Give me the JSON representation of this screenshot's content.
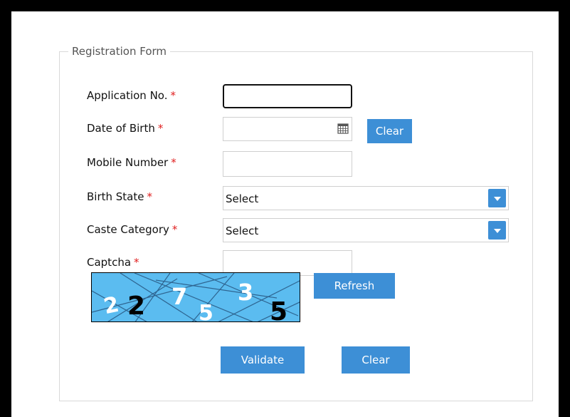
{
  "form": {
    "legend": "Registration Form",
    "required_mark": "*",
    "fields": {
      "application_no": {
        "label": "Application No.",
        "value": ""
      },
      "date_of_birth": {
        "label": "Date of Birth",
        "value": "",
        "clear_label": "Clear"
      },
      "mobile_number": {
        "label": "Mobile Number",
        "value": ""
      },
      "birth_state": {
        "label": "Birth State",
        "selected": "Select"
      },
      "caste_category": {
        "label": "Caste Category",
        "selected": "Select"
      },
      "captcha": {
        "label": "Captcha",
        "value": ""
      }
    },
    "captcha_image": {
      "digits": [
        "2",
        "2",
        "7",
        "5",
        "3",
        "5"
      ],
      "refresh_label": "Refresh"
    },
    "buttons": {
      "validate_label": "Validate",
      "clear_label": "Clear"
    }
  },
  "colors": {
    "accent": "#3d8fd6",
    "required": "#e02020",
    "captcha_bg": "#5bbcf0"
  },
  "icons": {
    "date_picker": "calendar-icon",
    "dropdown": "chevron-down-icon"
  }
}
